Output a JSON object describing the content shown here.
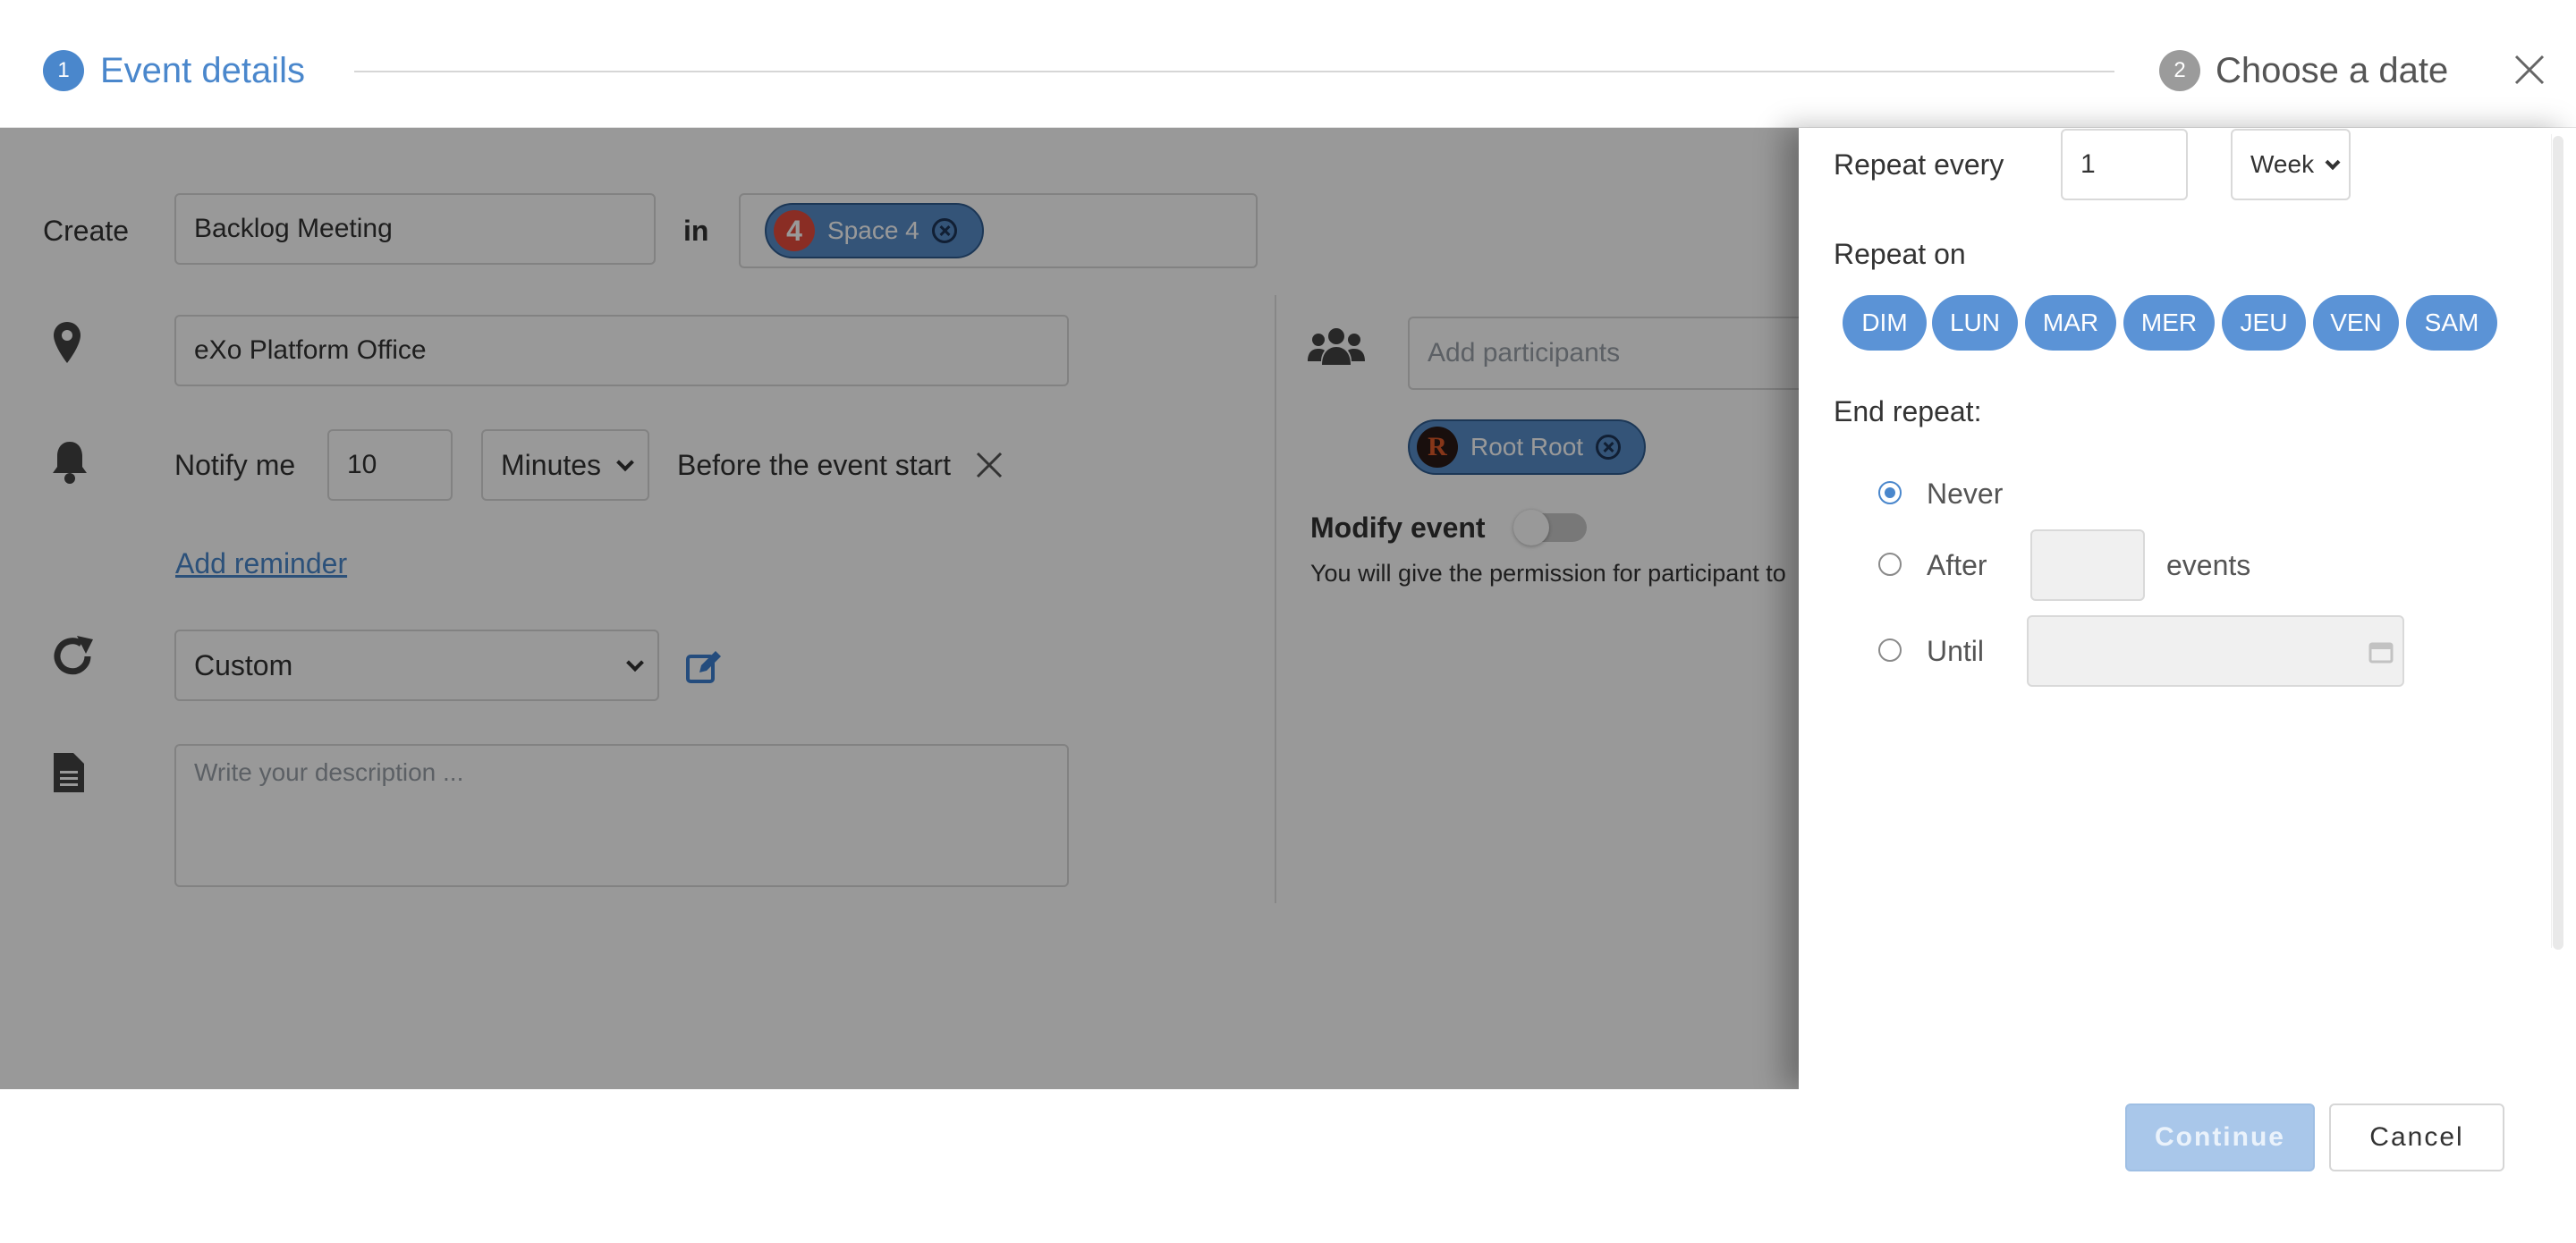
{
  "header": {
    "step1": {
      "number": "1",
      "label": "Event details"
    },
    "step2": {
      "number": "2",
      "label": "Choose a date"
    }
  },
  "form": {
    "create_label": "Create",
    "title_value": "Backlog Meeting",
    "in_label": "in",
    "space_chip": {
      "avatar": "4",
      "label": "Space 4"
    },
    "location_value": "eXo Platform Office",
    "notify_label": "Notify me",
    "notify_value": "10",
    "notify_unit": "Minutes",
    "before_label": "Before the event start",
    "add_reminder": "Add reminder",
    "recurrence_value": "Custom",
    "description_placeholder": "Write your description ...",
    "participants_placeholder": "Add participants",
    "participant_chip": {
      "avatar": "R",
      "label": "Root Root"
    },
    "modify_event_label": "Modify event",
    "permission_text": "You will give the permission for participant to"
  },
  "drawer": {
    "repeat_every_label": "Repeat every",
    "repeat_every_value": "1",
    "repeat_unit": "Week",
    "repeat_on_label": "Repeat on",
    "days": [
      "DIM",
      "LUN",
      "MAR",
      "MER",
      "JEU",
      "VEN",
      "SAM"
    ],
    "end_repeat_label": "End repeat:",
    "never_label": "Never",
    "after_label": "After",
    "events_label": "events",
    "until_label": "Until",
    "selected": "Never"
  },
  "footer": {
    "continue_label": "Continue",
    "cancel_label": "Cancel"
  },
  "colors": {
    "accent": "#4a87cc",
    "chip": "#578dc9",
    "day_pill": "#5b93d6",
    "continue_disabled": "#a9c7ea",
    "step_inactive": "#9b9b9b"
  }
}
